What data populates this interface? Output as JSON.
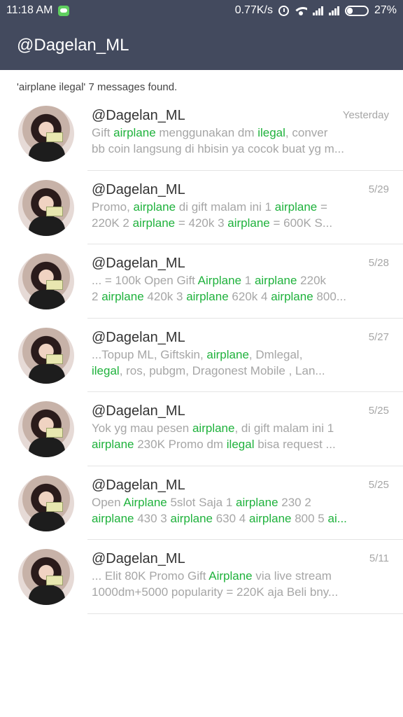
{
  "status_bar": {
    "time": "11:18 AM",
    "network_speed": "0.77K/s",
    "battery": "27%"
  },
  "header": {
    "title": "@Dagelan_ML"
  },
  "summary": "'airplane ilegal' 7 messages found.",
  "accent_color": "#1fb23c",
  "header_color": "#434a5e",
  "results": [
    {
      "name": "@Dagelan_ML",
      "date": "Yesterday",
      "lines": [
        [
          {
            "t": "Gift "
          },
          {
            "t": "airplane",
            "hl": true
          },
          {
            "t": " menggunakan dm "
          },
          {
            "t": "ilegal",
            "hl": true
          },
          {
            "t": ",  conver"
          }
        ],
        [
          {
            "t": "bb coin langsung di hbisin ya cocok buat yg m..."
          }
        ]
      ]
    },
    {
      "name": "@Dagelan_ML",
      "date": "5/29",
      "lines": [
        [
          {
            "t": "Promo,  "
          },
          {
            "t": "airplane",
            "hl": true
          },
          {
            "t": " di gift  malam ini  1 "
          },
          {
            "t": "airplane",
            "hl": true
          },
          {
            "t": "  ="
          }
        ],
        [
          {
            "t": "220K  2 "
          },
          {
            "t": "airplane",
            "hl": true
          },
          {
            "t": "  = 420k  3 "
          },
          {
            "t": "airplane",
            "hl": true
          },
          {
            "t": "  = 600K   S..."
          }
        ]
      ]
    },
    {
      "name": "@Dagelan_ML",
      "date": "5/28",
      "lines": [
        [
          {
            "t": "... = 100k   Open Gift "
          },
          {
            "t": "Airplane",
            "hl": true
          },
          {
            "t": "  1 "
          },
          {
            "t": "airplane",
            "hl": true
          },
          {
            "t": " 220k"
          }
        ],
        [
          {
            "t": "2 "
          },
          {
            "t": "airplane",
            "hl": true
          },
          {
            "t": " 420k 3 "
          },
          {
            "t": "airplane",
            "hl": true
          },
          {
            "t": " 620k 4 "
          },
          {
            "t": "airplane",
            "hl": true
          },
          {
            "t": " 800..."
          }
        ]
      ]
    },
    {
      "name": "@Dagelan_ML",
      "date": "5/27",
      "lines": [
        [
          {
            "t": "...Topup  ML,  Giftskin,  "
          },
          {
            "t": "airplane",
            "hl": true
          },
          {
            "t": ",  Dmlegal,"
          }
        ],
        [
          {
            "t": "ilegal",
            "hl": true
          },
          {
            "t": ",  ros,  pubgm,  Dragonest  Mobile ,    Lan..."
          }
        ]
      ]
    },
    {
      "name": "@Dagelan_ML",
      "date": "5/25",
      "lines": [
        [
          {
            "t": "Yok yg mau pesen  "
          },
          {
            "t": "airplane",
            "hl": true
          },
          {
            "t": ",  di gift malam ini   1"
          }
        ],
        [
          {
            "t": "airplane",
            "hl": true
          },
          {
            "t": "  230K   Promo dm "
          },
          {
            "t": "ilegal",
            "hl": true
          },
          {
            "t": "  bisa request ..."
          }
        ]
      ]
    },
    {
      "name": "@Dagelan_ML",
      "date": "5/25",
      "lines": [
        [
          {
            "t": "Open "
          },
          {
            "t": "Airplane",
            "hl": true
          },
          {
            "t": " 5slot Saja  1 "
          },
          {
            "t": "airplane",
            "hl": true
          },
          {
            "t": "  230 2"
          }
        ],
        [
          {
            "t": "airplane",
            "hl": true
          },
          {
            "t": "  430 3 "
          },
          {
            "t": "airplane",
            "hl": true
          },
          {
            "t": " 630 4 "
          },
          {
            "t": "airplane",
            "hl": true
          },
          {
            "t": " 800 5 "
          },
          {
            "t": "ai...",
            "hl": true
          }
        ]
      ]
    },
    {
      "name": "@Dagelan_ML",
      "date": "5/11",
      "lines": [
        [
          {
            "t": "...  Elit 80K   Promo  Gift "
          },
          {
            "t": "Airplane",
            "hl": true
          },
          {
            "t": " via live stream"
          }
        ],
        [
          {
            "t": "1000dm+5000 popularity = 220K aja   Beli bny..."
          }
        ]
      ]
    }
  ]
}
